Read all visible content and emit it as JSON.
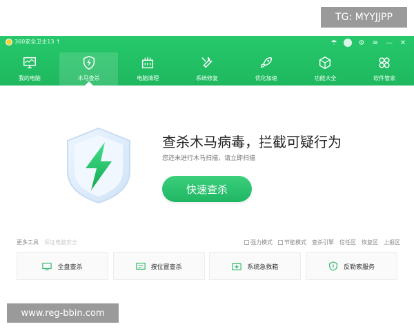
{
  "overlay": {
    "tg_text": "TG: MYYJJPP",
    "url_text": "www.reg-bbin.com"
  },
  "app": {
    "title": "360安全卫士13 ↑"
  },
  "toolbar": {
    "items": [
      {
        "label": "我的电脑",
        "icon": "computer-icon"
      },
      {
        "label": "木马查杀",
        "icon": "shield-icon"
      },
      {
        "label": "电脑清理",
        "icon": "broom-icon"
      },
      {
        "label": "系统修复",
        "icon": "wrench-icon"
      },
      {
        "label": "优化加速",
        "icon": "rocket-icon"
      },
      {
        "label": "功能大全",
        "icon": "cube-icon"
      },
      {
        "label": "软件管家",
        "icon": "grid-icon"
      }
    ],
    "active_index": 1
  },
  "main": {
    "headline": "查杀木马病毒，拦截可疑行为",
    "subline": "您还未进行木马扫描，请立即扫描",
    "scan_button": "快速查杀"
  },
  "bottom": {
    "left_text": "更多工具",
    "left_sub": "保证电脑安全",
    "options": [
      "强力模式",
      "节能模式"
    ],
    "links": [
      "查杀引擎",
      "信任区",
      "恢复区",
      "上报区"
    ]
  },
  "cards": [
    {
      "label": "全盘查杀",
      "icon": "disk-icon"
    },
    {
      "label": "按位置查杀",
      "icon": "folder-icon"
    },
    {
      "label": "系统急救箱",
      "icon": "firstaid-icon"
    },
    {
      "label": "反勒索服务",
      "icon": "shield-lock-icon"
    }
  ],
  "colors": {
    "brand_green": "#1fb85f",
    "button_green": "#2fc671"
  }
}
